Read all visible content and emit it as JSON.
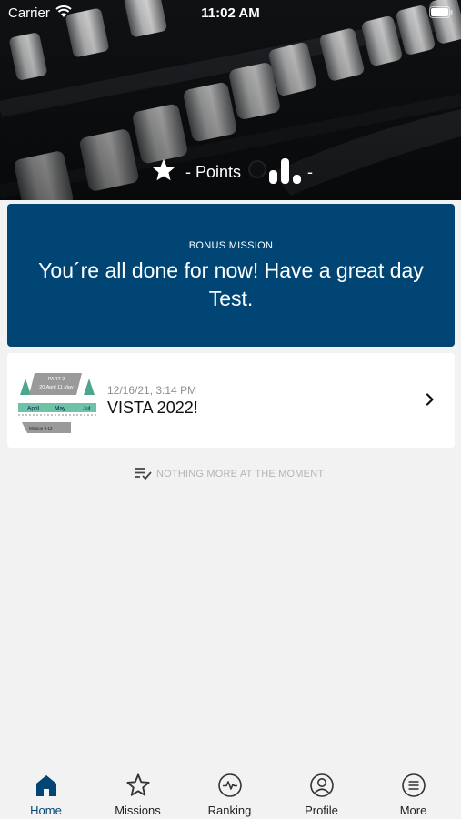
{
  "status_bar": {
    "carrier": "Carrier",
    "time": "11:02 AM"
  },
  "header": {
    "points_text": "- Points",
    "ranking_text": "-"
  },
  "bonus": {
    "kicker": "BONUS MISSION",
    "message": "You´re all done for now! Have a great day Test."
  },
  "missions": [
    {
      "date": "12/16/21, 3:14 PM",
      "title": "VISTA 2022!",
      "thumb": {
        "part": "PART 2",
        "dates": "20 April 11 May",
        "months": [
          "April",
          "May",
          "Jul"
        ],
        "tag": "Mission 9-12"
      }
    }
  ],
  "empty_state": {
    "text": "NOTHING MORE AT THE MOMENT"
  },
  "tabs": [
    {
      "label": "Home",
      "icon": "home-icon",
      "active": true
    },
    {
      "label": "Missions",
      "icon": "star-icon",
      "active": false
    },
    {
      "label": "Ranking",
      "icon": "pulse-icon",
      "active": false
    },
    {
      "label": "Profile",
      "icon": "user-icon",
      "active": false
    },
    {
      "label": "More",
      "icon": "menu-icon",
      "active": false
    }
  ],
  "colors": {
    "accent": "#004574",
    "background": "#f2f2f2",
    "card": "#ffffff"
  }
}
